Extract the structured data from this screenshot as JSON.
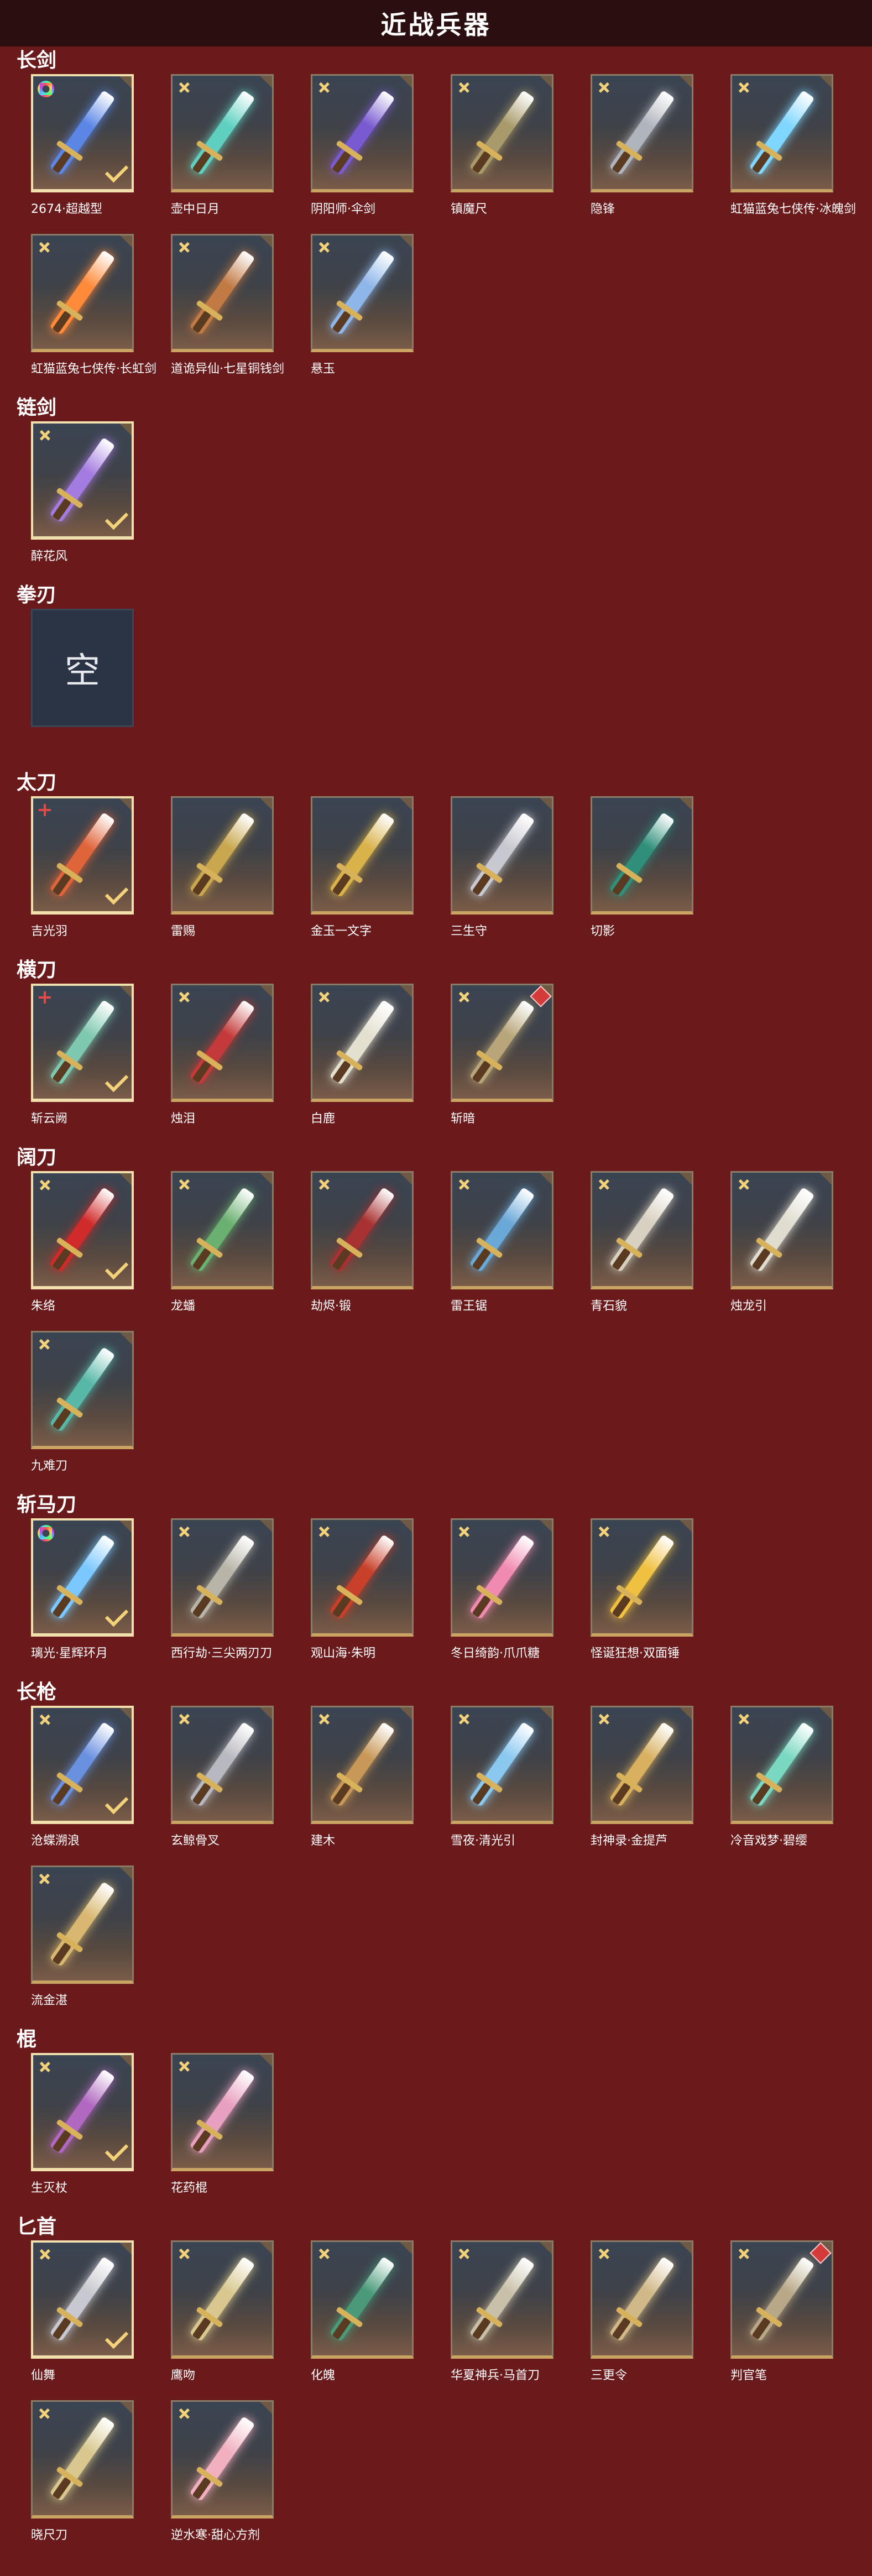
{
  "title": "近战兵器",
  "empty_label": "空",
  "categories": [
    {
      "name": "长剑",
      "items": [
        {
          "label": "2674·超越型",
          "badge": "rainbow",
          "selected": true,
          "color": "#5b86e6"
        },
        {
          "label": "壶中日月",
          "badge": "gold",
          "color": "#5fd0c0"
        },
        {
          "label": "阴阳师·伞剑",
          "badge": "gold",
          "color": "#7a5ad0"
        },
        {
          "label": "镇魔尺",
          "badge": "gold",
          "color": "#a89a6a"
        },
        {
          "label": "隐锋",
          "badge": "gold",
          "color": "#b0b4bc"
        },
        {
          "label": "虹猫蓝兔七侠传·冰魄剑",
          "badge": "gold",
          "color": "#7fd6ff"
        },
        {
          "label": "虹猫蓝兔七侠传·长虹剑",
          "badge": "gold",
          "color": "#ff8a3a"
        },
        {
          "label": "道诡异仙·七星铜钱剑",
          "badge": "gold",
          "color": "#c27a44"
        },
        {
          "label": "悬玉",
          "badge": "gold",
          "color": "#8fb6e8"
        }
      ]
    },
    {
      "name": "链剑",
      "items": [
        {
          "label": "醉花风",
          "badge": "gold",
          "selected": true,
          "color": "#a47be0"
        }
      ]
    },
    {
      "name": "拳刃",
      "items": [
        {
          "label": "",
          "empty": true
        }
      ]
    },
    {
      "name": "太刀",
      "items": [
        {
          "label": "吉光羽",
          "badge": "red",
          "selected": true,
          "color": "#e0643a"
        },
        {
          "label": "雷赐",
          "badge": "none",
          "color": "#c9a74e"
        },
        {
          "label": "金玉一文字",
          "badge": "none",
          "color": "#d9b24a"
        },
        {
          "label": "三生守",
          "badge": "none",
          "color": "#c8c8d0"
        },
        {
          "label": "切影",
          "badge": "none",
          "color": "#2f8f7a"
        }
      ]
    },
    {
      "name": "横刀",
      "items": [
        {
          "label": "斩云阙",
          "badge": "red",
          "selected": true,
          "color": "#7fc8b0"
        },
        {
          "label": "烛泪",
          "badge": "gold",
          "color": "#c43a3a"
        },
        {
          "label": "白鹿",
          "badge": "gold",
          "color": "#e4e0d0"
        },
        {
          "label": "斩暗",
          "badge": "gold",
          "corner_red": true,
          "color": "#b8a67a"
        }
      ]
    },
    {
      "name": "阔刀",
      "items": [
        {
          "label": "朱络",
          "badge": "gold",
          "selected": true,
          "color": "#d02a2a"
        },
        {
          "label": "龙蟠",
          "badge": "gold",
          "color": "#6ab070"
        },
        {
          "label": "劫烬·锻",
          "badge": "gold",
          "color": "#a83232"
        },
        {
          "label": "雷王锯",
          "badge": "gold",
          "color": "#6aa8d8"
        },
        {
          "label": "青石貌",
          "badge": "gold",
          "color": "#d8d0c0"
        },
        {
          "label": "烛龙引",
          "badge": "gold",
          "color": "#e0dcd0"
        },
        {
          "label": "九难刀",
          "badge": "gold",
          "color": "#58b8a8"
        }
      ]
    },
    {
      "name": "斩马刀",
      "items": [
        {
          "label": "璃光·星辉环月",
          "badge": "rainbow",
          "selected": true,
          "color": "#7ac8ff"
        },
        {
          "label": "西行劫·三尖两刃刀",
          "badge": "gold",
          "color": "#b8b4a8"
        },
        {
          "label": "观山海·朱明",
          "badge": "gold",
          "color": "#c8402a"
        },
        {
          "label": "冬日绮韵·爪爪糖",
          "badge": "gold",
          "color": "#f08ab0"
        },
        {
          "label": "怪诞狂想·双面锤",
          "badge": "gold",
          "color": "#f0c040"
        }
      ]
    },
    {
      "name": "长枪",
      "items": [
        {
          "label": "沧蝶溯浪",
          "badge": "gold",
          "selected": true,
          "color": "#6a90e0"
        },
        {
          "label": "玄鲸骨叉",
          "badge": "gold",
          "color": "#b8b8c0"
        },
        {
          "label": "建木",
          "badge": "gold",
          "color": "#c89858"
        },
        {
          "label": "雪夜·清光引",
          "badge": "gold",
          "color": "#8ac8f0"
        },
        {
          "label": "封神录·金提芦",
          "badge": "gold",
          "color": "#d8b060"
        },
        {
          "label": "冷音戏梦·碧缨",
          "badge": "gold",
          "color": "#7ad8c0"
        },
        {
          "label": "流金湛",
          "badge": "gold",
          "color": "#d8b870"
        }
      ]
    },
    {
      "name": "棍",
      "items": [
        {
          "label": "生灭杖",
          "badge": "gold",
          "selected": true,
          "color": "#b068c0"
        },
        {
          "label": "花药棍",
          "badge": "gold",
          "color": "#e8a0c0"
        }
      ]
    },
    {
      "name": "匕首",
      "items": [
        {
          "label": "仙舞",
          "badge": "gold",
          "selected": true,
          "color": "#c8c8d0"
        },
        {
          "label": "鹰吻",
          "badge": "gold",
          "color": "#d8c890"
        },
        {
          "label": "化魄",
          "badge": "gold",
          "color": "#4a9a7a"
        },
        {
          "label": "华夏神兵·马首刀",
          "badge": "gold",
          "color": "#c8c0a8"
        },
        {
          "label": "三更令",
          "badge": "gold",
          "color": "#d0b888"
        },
        {
          "label": "判官笔",
          "badge": "gold",
          "corner_red": true,
          "color": "#b8a888"
        },
        {
          "label": "晓尺刀",
          "badge": "gold",
          "color": "#d8c890"
        },
        {
          "label": "逆水寒·甜心方剂",
          "badge": "gold",
          "color": "#f0b0c0"
        }
      ]
    }
  ]
}
